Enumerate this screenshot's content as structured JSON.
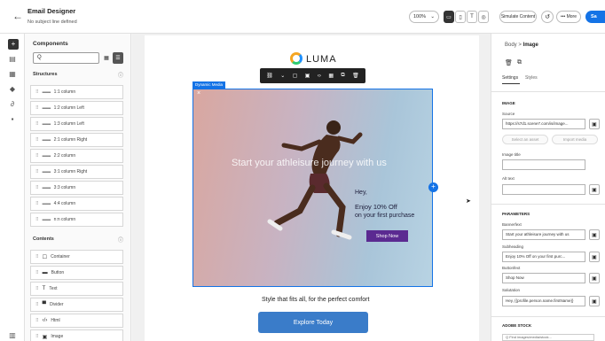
{
  "header": {
    "back_icon": "←",
    "title": "Email Designer",
    "subtitle": "No subject line defined",
    "zoom": "100%",
    "simulate": "Simulate Content",
    "more": "••• More",
    "save": "Sa"
  },
  "rail": {
    "icons": [
      "plus-icon",
      "layout-icon",
      "image-icon",
      "layers-icon",
      "link-icon",
      "grid-icon",
      "settings-icon"
    ]
  },
  "components": {
    "title": "Components",
    "search_placeholder": "Q",
    "structures_label": "Structures",
    "structures": [
      "1:1 column",
      "1:2 column Left",
      "1:3 column Left",
      "2:1 column Right",
      "2:2 column",
      "3:1 column Right",
      "3:3 column",
      "4:4 column",
      "n:n column"
    ],
    "contents_label": "Contents",
    "contents": [
      {
        "icon": "☐",
        "label": "Container"
      },
      {
        "icon": "▬",
        "label": "Button"
      },
      {
        "icon": "T",
        "label": "Text"
      },
      {
        "icon": "▀",
        "label": "Divider"
      },
      {
        "icon": "‹/›",
        "label": "Html"
      },
      {
        "icon": "▣",
        "label": "Image"
      }
    ]
  },
  "canvas": {
    "logo": "LUMA",
    "badge": "Dynamic Media",
    "hero_text": "Start your athleisure journey with us",
    "hey": "Hey,",
    "offer_line1": "Enjoy 10% Off",
    "offer_line2": "on your first purchase",
    "shop_button": "Shop Now",
    "tagline": "Style that fits all, for the perfect comfort",
    "explore_button": "Explore Today"
  },
  "properties": {
    "crumb_parent": "Body",
    "crumb_sep": ">",
    "crumb_current": "Image",
    "tab_settings": "Settings",
    "tab_styles": "Styles",
    "image_section": "IMAGE",
    "source_label": "Source",
    "source_value": "https://s7d1.scene7.com/is/image...",
    "select_asset": "Select an asset",
    "import_media": "Import media",
    "image_title_label": "Image title",
    "alt_text_label": "Alt text",
    "parameters_section": "PARAMETERS",
    "banner_label": "Bannerfext",
    "banner_value": "Start your athleisure journey with us",
    "subheading_label": "Subheading",
    "subheading_value": "Enjoy 10% Off on your first purc...",
    "button_label": "Buttonfext",
    "button_value": "Shop Now",
    "salutation_label": "Salutation",
    "salutation_value": "Hey, {{profile.person.name.firstName}}",
    "adobe_stock": "ADOBE STOCK",
    "bottom_field": "Q  Find images/media/stock..."
  }
}
